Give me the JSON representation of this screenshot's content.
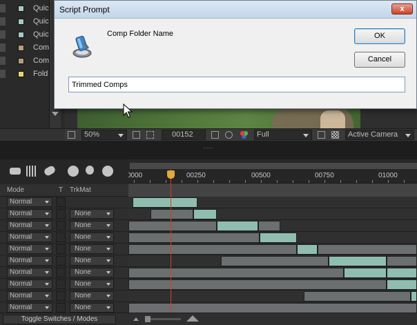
{
  "project_items": [
    {
      "label": "Quicl",
      "swatch": "#a9c8c0"
    },
    {
      "label": "Quicl",
      "swatch": "#a9c8c0"
    },
    {
      "label": "Quicl",
      "swatch": "#a9c8c0"
    },
    {
      "label": "Comp",
      "swatch": "#b49e7c"
    },
    {
      "label": "Comi",
      "swatch": "#b49e7c"
    },
    {
      "label": "Fold",
      "swatch": "#e8d46c"
    }
  ],
  "viewer_bar": {
    "zoom": "50%",
    "timecode": "00152",
    "resolution": "Full",
    "camera": "Active Camera"
  },
  "dialog": {
    "title": "Script Prompt",
    "close_label": "x",
    "prompt": "Comp Folder Name",
    "input_value": "Trimmed Comps",
    "ok_label": "OK",
    "cancel_label": "Cancel"
  },
  "timeline": {
    "headers": {
      "mode": "Mode",
      "t": "T",
      "trkmat": "TrkMat"
    },
    "ruler_labels": [
      "0000",
      "00250",
      "00500",
      "00750",
      "01000"
    ],
    "rows": [
      {
        "mode": "Normal",
        "trkmat": ""
      },
      {
        "mode": "Normal",
        "trkmat": "None"
      },
      {
        "mode": "Normal",
        "trkmat": "None"
      },
      {
        "mode": "Normal",
        "trkmat": "None"
      },
      {
        "mode": "Normal",
        "trkmat": "None"
      },
      {
        "mode": "Normal",
        "trkmat": "None"
      },
      {
        "mode": "Normal",
        "trkmat": "None"
      },
      {
        "mode": "Normal",
        "trkmat": "None"
      },
      {
        "mode": "Normal",
        "trkmat": "None"
      },
      {
        "mode": "Normal",
        "trkmat": "None"
      }
    ],
    "toggle_label": "Toggle Switches / Modes",
    "current_frame": 152
  },
  "colors": {
    "clip_highlight": "#8fbeb0",
    "clip_dim": "#6b6f6f",
    "playhead": "#d43a2f"
  }
}
